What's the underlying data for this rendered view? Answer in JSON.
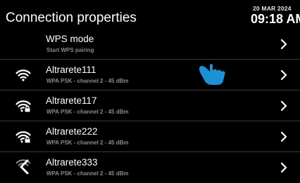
{
  "header": {
    "title": "Connection properties",
    "date": "20 MAR 2024",
    "time": "09:18 AM"
  },
  "colors": {
    "background": "#000000",
    "accent": "#1e90d6",
    "subtext": "#8a8a8a",
    "divider": "#3a3a3a"
  },
  "rows": [
    {
      "name": "WPS mode",
      "sub": "Start WPS pairing",
      "icon": "none"
    },
    {
      "name": "Altrarete111",
      "sub": "WPA PSK - channel 2 - 45 dBm",
      "icon": "wifi-icon"
    },
    {
      "name": "Altrarete117",
      "sub": "WPA PSK - channel 2 - 45 dBm",
      "icon": "wifi-lock-icon"
    },
    {
      "name": "Altrarete222",
      "sub": "WPA PSK - channel 2 - 45 dBm",
      "icon": "wifi-lock-icon"
    },
    {
      "name": "Altrarete333",
      "sub": "WPA PSK - channel 2 - 45 dBm",
      "icon": "wifi-lock-icon"
    }
  ],
  "icons": {
    "back": "chevron-left-icon",
    "row_action": "chevron-right-icon",
    "pointer": "hand-pointer-icon"
  }
}
